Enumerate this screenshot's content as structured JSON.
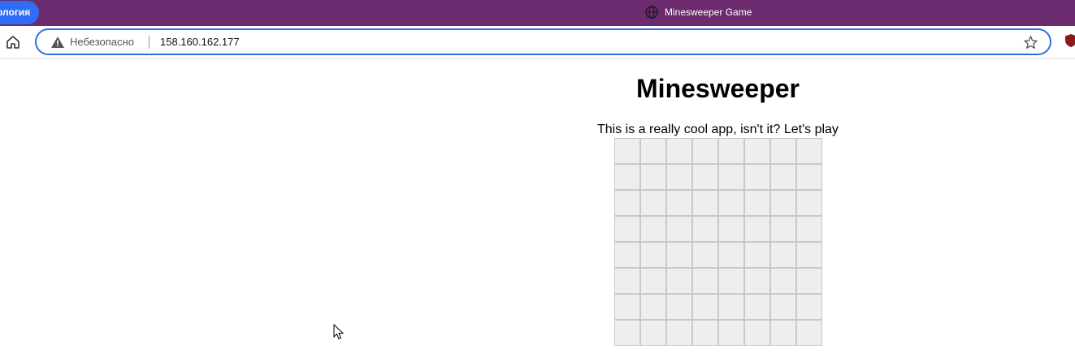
{
  "browser": {
    "tab_label": "ология",
    "window_title": "Minesweeper Game",
    "security_label": "Небезопасно",
    "url": "158.160.162.177",
    "icons": [
      "globe-icon",
      "home-icon",
      "warning-icon",
      "star-icon",
      "extension-icon",
      "cursor-icon"
    ]
  },
  "page": {
    "title": "Minesweeper",
    "subtitle": "This is a really cool app, isn't it? Let's play"
  },
  "board": {
    "rows": 8,
    "cols": 8,
    "cell_color": "#eeeeee",
    "grid_color": "#c8c8c8"
  },
  "colors": {
    "titlebar": "#6b2b6e",
    "tab_accent": "#2f6df6",
    "address_border": "#2e6fe0"
  }
}
